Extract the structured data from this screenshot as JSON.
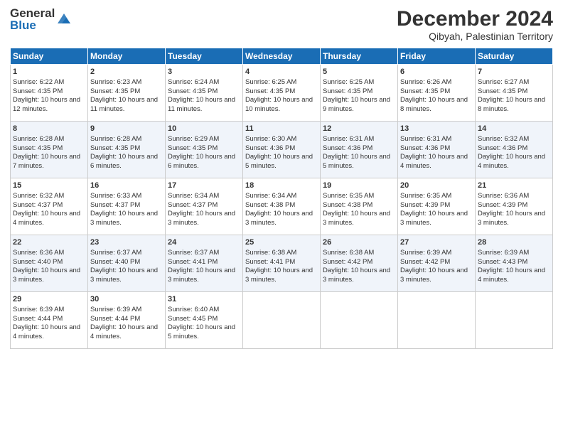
{
  "header": {
    "logo_general": "General",
    "logo_blue": "Blue",
    "month_title": "December 2024",
    "location": "Qibyah, Palestinian Territory"
  },
  "days_of_week": [
    "Sunday",
    "Monday",
    "Tuesday",
    "Wednesday",
    "Thursday",
    "Friday",
    "Saturday"
  ],
  "weeks": [
    [
      {
        "day": "1",
        "sunrise": "Sunrise: 6:22 AM",
        "sunset": "Sunset: 4:35 PM",
        "daylight": "Daylight: 10 hours and 12 minutes."
      },
      {
        "day": "2",
        "sunrise": "Sunrise: 6:23 AM",
        "sunset": "Sunset: 4:35 PM",
        "daylight": "Daylight: 10 hours and 11 minutes."
      },
      {
        "day": "3",
        "sunrise": "Sunrise: 6:24 AM",
        "sunset": "Sunset: 4:35 PM",
        "daylight": "Daylight: 10 hours and 11 minutes."
      },
      {
        "day": "4",
        "sunrise": "Sunrise: 6:25 AM",
        "sunset": "Sunset: 4:35 PM",
        "daylight": "Daylight: 10 hours and 10 minutes."
      },
      {
        "day": "5",
        "sunrise": "Sunrise: 6:25 AM",
        "sunset": "Sunset: 4:35 PM",
        "daylight": "Daylight: 10 hours and 9 minutes."
      },
      {
        "day": "6",
        "sunrise": "Sunrise: 6:26 AM",
        "sunset": "Sunset: 4:35 PM",
        "daylight": "Daylight: 10 hours and 8 minutes."
      },
      {
        "day": "7",
        "sunrise": "Sunrise: 6:27 AM",
        "sunset": "Sunset: 4:35 PM",
        "daylight": "Daylight: 10 hours and 8 minutes."
      }
    ],
    [
      {
        "day": "8",
        "sunrise": "Sunrise: 6:28 AM",
        "sunset": "Sunset: 4:35 PM",
        "daylight": "Daylight: 10 hours and 7 minutes."
      },
      {
        "day": "9",
        "sunrise": "Sunrise: 6:28 AM",
        "sunset": "Sunset: 4:35 PM",
        "daylight": "Daylight: 10 hours and 6 minutes."
      },
      {
        "day": "10",
        "sunrise": "Sunrise: 6:29 AM",
        "sunset": "Sunset: 4:35 PM",
        "daylight": "Daylight: 10 hours and 6 minutes."
      },
      {
        "day": "11",
        "sunrise": "Sunrise: 6:30 AM",
        "sunset": "Sunset: 4:36 PM",
        "daylight": "Daylight: 10 hours and 5 minutes."
      },
      {
        "day": "12",
        "sunrise": "Sunrise: 6:31 AM",
        "sunset": "Sunset: 4:36 PM",
        "daylight": "Daylight: 10 hours and 5 minutes."
      },
      {
        "day": "13",
        "sunrise": "Sunrise: 6:31 AM",
        "sunset": "Sunset: 4:36 PM",
        "daylight": "Daylight: 10 hours and 4 minutes."
      },
      {
        "day": "14",
        "sunrise": "Sunrise: 6:32 AM",
        "sunset": "Sunset: 4:36 PM",
        "daylight": "Daylight: 10 hours and 4 minutes."
      }
    ],
    [
      {
        "day": "15",
        "sunrise": "Sunrise: 6:32 AM",
        "sunset": "Sunset: 4:37 PM",
        "daylight": "Daylight: 10 hours and 4 minutes."
      },
      {
        "day": "16",
        "sunrise": "Sunrise: 6:33 AM",
        "sunset": "Sunset: 4:37 PM",
        "daylight": "Daylight: 10 hours and 3 minutes."
      },
      {
        "day": "17",
        "sunrise": "Sunrise: 6:34 AM",
        "sunset": "Sunset: 4:37 PM",
        "daylight": "Daylight: 10 hours and 3 minutes."
      },
      {
        "day": "18",
        "sunrise": "Sunrise: 6:34 AM",
        "sunset": "Sunset: 4:38 PM",
        "daylight": "Daylight: 10 hours and 3 minutes."
      },
      {
        "day": "19",
        "sunrise": "Sunrise: 6:35 AM",
        "sunset": "Sunset: 4:38 PM",
        "daylight": "Daylight: 10 hours and 3 minutes."
      },
      {
        "day": "20",
        "sunrise": "Sunrise: 6:35 AM",
        "sunset": "Sunset: 4:39 PM",
        "daylight": "Daylight: 10 hours and 3 minutes."
      },
      {
        "day": "21",
        "sunrise": "Sunrise: 6:36 AM",
        "sunset": "Sunset: 4:39 PM",
        "daylight": "Daylight: 10 hours and 3 minutes."
      }
    ],
    [
      {
        "day": "22",
        "sunrise": "Sunrise: 6:36 AM",
        "sunset": "Sunset: 4:40 PM",
        "daylight": "Daylight: 10 hours and 3 minutes."
      },
      {
        "day": "23",
        "sunrise": "Sunrise: 6:37 AM",
        "sunset": "Sunset: 4:40 PM",
        "daylight": "Daylight: 10 hours and 3 minutes."
      },
      {
        "day": "24",
        "sunrise": "Sunrise: 6:37 AM",
        "sunset": "Sunset: 4:41 PM",
        "daylight": "Daylight: 10 hours and 3 minutes."
      },
      {
        "day": "25",
        "sunrise": "Sunrise: 6:38 AM",
        "sunset": "Sunset: 4:41 PM",
        "daylight": "Daylight: 10 hours and 3 minutes."
      },
      {
        "day": "26",
        "sunrise": "Sunrise: 6:38 AM",
        "sunset": "Sunset: 4:42 PM",
        "daylight": "Daylight: 10 hours and 3 minutes."
      },
      {
        "day": "27",
        "sunrise": "Sunrise: 6:39 AM",
        "sunset": "Sunset: 4:42 PM",
        "daylight": "Daylight: 10 hours and 3 minutes."
      },
      {
        "day": "28",
        "sunrise": "Sunrise: 6:39 AM",
        "sunset": "Sunset: 4:43 PM",
        "daylight": "Daylight: 10 hours and 4 minutes."
      }
    ],
    [
      {
        "day": "29",
        "sunrise": "Sunrise: 6:39 AM",
        "sunset": "Sunset: 4:44 PM",
        "daylight": "Daylight: 10 hours and 4 minutes."
      },
      {
        "day": "30",
        "sunrise": "Sunrise: 6:39 AM",
        "sunset": "Sunset: 4:44 PM",
        "daylight": "Daylight: 10 hours and 4 minutes."
      },
      {
        "day": "31",
        "sunrise": "Sunrise: 6:40 AM",
        "sunset": "Sunset: 4:45 PM",
        "daylight": "Daylight: 10 hours and 5 minutes."
      },
      null,
      null,
      null,
      null
    ]
  ]
}
